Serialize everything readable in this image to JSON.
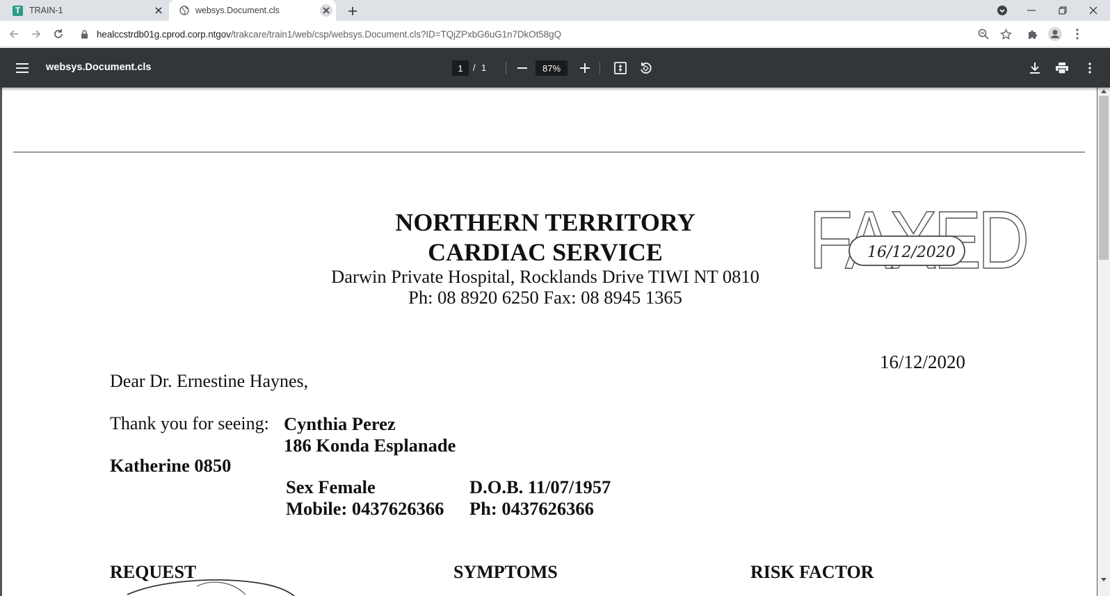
{
  "browser": {
    "tabs": [
      {
        "title": "TRAIN-1",
        "icon": "t-favicon-icon",
        "active": false
      },
      {
        "title": "websys.Document.cls",
        "icon": "globe-icon",
        "active": true
      }
    ],
    "address_bar": {
      "host": "healccstrdb01g.cprod.corp.ntgov",
      "path": "/trakcare/train1/web/csp/websys.Document.cls?ID=TQjZPxbG6uG1n7DkOt58gQ"
    }
  },
  "pdf_viewer": {
    "title": "websys.Document.cls",
    "current_page": "1",
    "separator": "/",
    "total_pages": "1",
    "zoom": "87%"
  },
  "document": {
    "org_line1": "NORTHERN TERRITORY",
    "org_line2": "CARDIAC SERVICE",
    "address": "Darwin Private Hospital, Rocklands Drive TIWI NT 0810",
    "phone_fax": "Ph: 08 8920 6250 Fax: 08 8945 1365",
    "stamp": {
      "word": "FAXED",
      "date": "16/12/2020"
    },
    "date": "16/12/2020",
    "salutation": "Dear Dr. Ernestine Haynes,",
    "thanks_prefix": "Thank you for seeing:",
    "patient": {
      "name": "Cynthia Perez",
      "street": "186 Konda Esplanade",
      "suburb": "Katherine 0850",
      "sex": "Sex Female",
      "dob": "D.O.B. 11/07/1957",
      "mobile": "Mobile: 0437626366",
      "phone": "Ph: 0437626366"
    },
    "sections": {
      "request": "REQUEST",
      "symptoms": "SYMPTOMS",
      "risk_factor": "RISK FACTOR"
    }
  },
  "colors": {
    "tabstrip_bg": "#dee1e6",
    "pdf_toolbar_bg": "#323639",
    "viewer_bg": "#525659",
    "favicon_green": "#2e9b87"
  }
}
